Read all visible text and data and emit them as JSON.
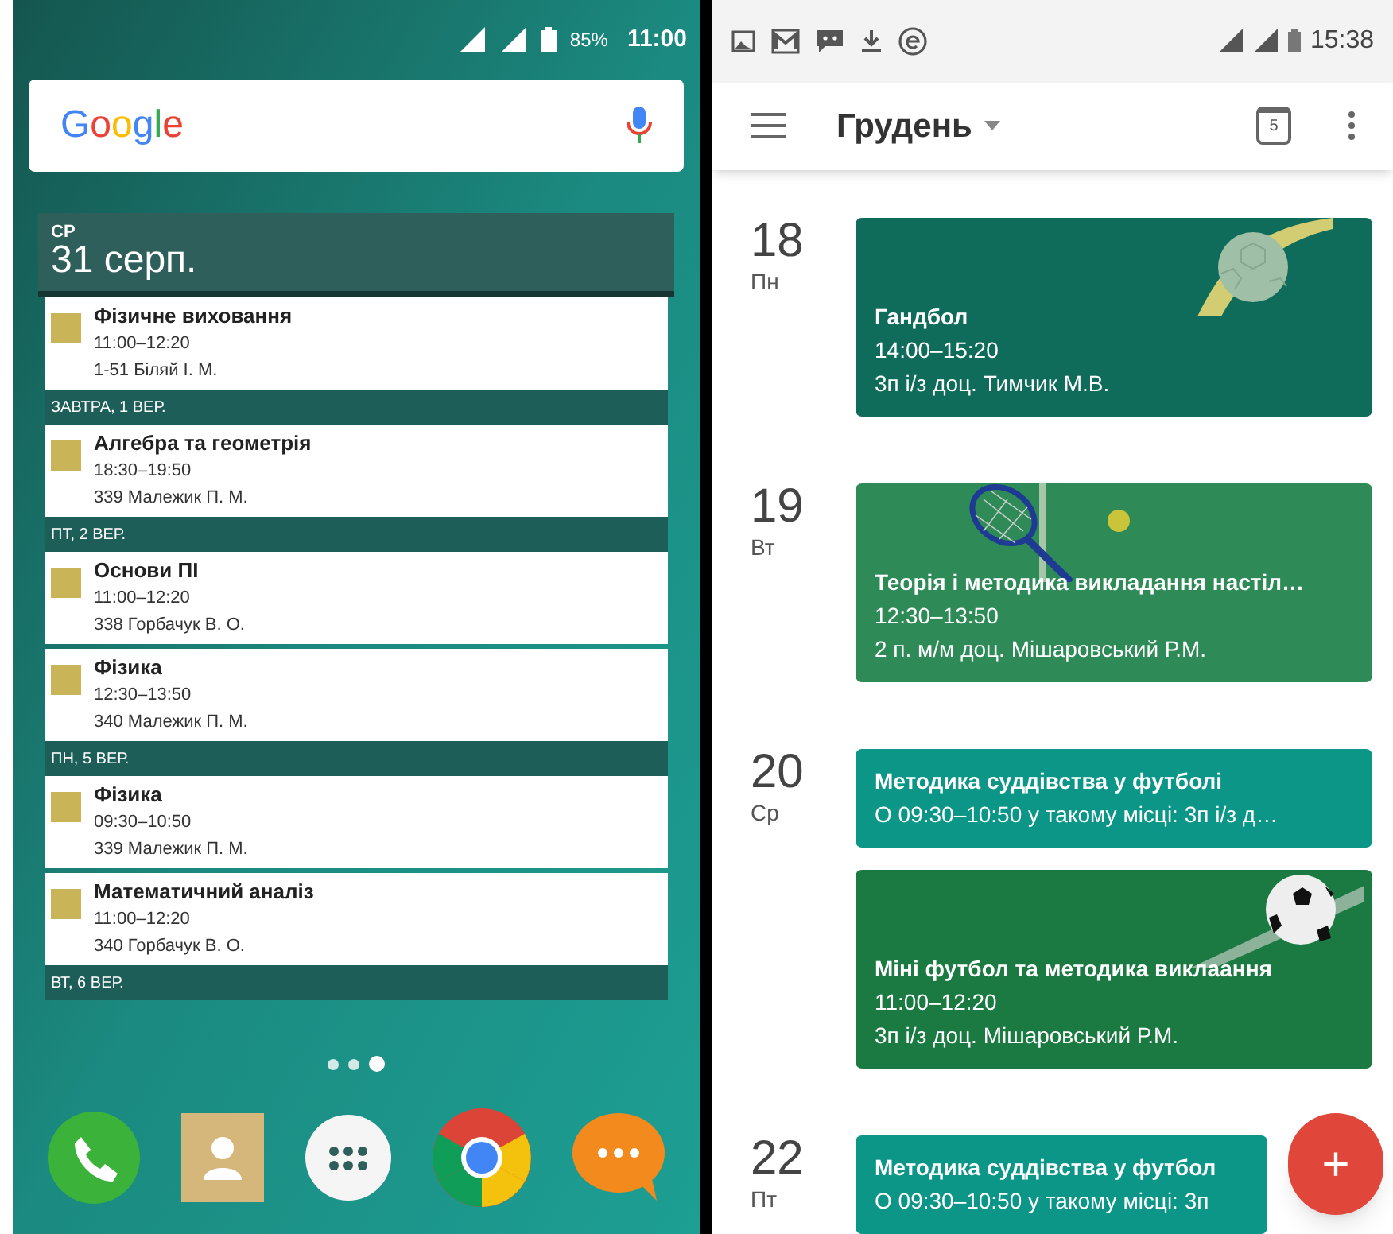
{
  "home_screen": {
    "status_bar": {
      "battery": "85%",
      "time": "11:00"
    },
    "search_bar": {
      "logo": "Google"
    },
    "agenda_widget": {
      "weekday": "СР",
      "date": "31 серп.",
      "items": [
        {
          "kind": "event",
          "title": "Фізичне виховання",
          "time": "11:00–12:20",
          "place": "1-51 Біляй І. М.",
          "color": "#c9b458"
        },
        {
          "kind": "day",
          "label": "ЗАВТРА, 1 ВЕР."
        },
        {
          "kind": "event",
          "title": "Алгебра та геометрія",
          "time": "18:30–19:50",
          "place": "339 Малежик П. М.",
          "color": "#c9b458"
        },
        {
          "kind": "day",
          "label": "ПТ, 2 ВЕР."
        },
        {
          "kind": "event",
          "title": "Основи ПІ",
          "time": "11:00–12:20",
          "place": "338 Горбачук В. О.",
          "color": "#c9b458"
        },
        {
          "kind": "event",
          "title": "Фізика",
          "time": "12:30–13:50",
          "place": "340 Малежик П. М.",
          "color": "#c9b458"
        },
        {
          "kind": "day",
          "label": "ПН, 5 ВЕР."
        },
        {
          "kind": "event",
          "title": "Фізика",
          "time": "09:30–10:50",
          "place": "339 Малежик П. М.",
          "color": "#c9b458"
        },
        {
          "kind": "event",
          "title": "Математичний аналіз",
          "time": "11:00–12:20",
          "place": "340 Горбачук В. О.",
          "color": "#c9b458"
        },
        {
          "kind": "day",
          "label": "ВТ, 6 ВЕР."
        }
      ]
    },
    "page_dots": [
      {
        "selected": false
      },
      {
        "selected": false
      },
      {
        "selected": true
      }
    ],
    "dock": [
      {
        "kind": "phone"
      },
      {
        "kind": "contacts"
      },
      {
        "kind": "apps"
      },
      {
        "kind": "browser"
      },
      {
        "kind": "messages"
      }
    ]
  },
  "calendar_app": {
    "status_bar": {
      "time": "15:38"
    },
    "app_bar": {
      "title": "Грудень",
      "today_icon_day": "5"
    },
    "days": [
      {
        "day": "18",
        "weekday": "Пн",
        "events": [
          {
            "kind": "handball",
            "title": "Гандбол",
            "time": "14:00–15:20",
            "place": "3п і/з доц. Тимчик М.В."
          }
        ]
      },
      {
        "day": "19",
        "weekday": "Вт",
        "events": [
          {
            "kind": "tennis",
            "title": "Теорія і методика викладання настіл…",
            "time": "12:30–13:50",
            "place": "2 п. м/м доц. Мішаровський Р.М."
          }
        ]
      },
      {
        "day": "20",
        "weekday": "Ср",
        "events": [
          {
            "kind": "plain",
            "title": "Методика суддівства у футболі",
            "subtitle": "О 09:30–10:50 у такому місці: 3п і/з д…"
          },
          {
            "kind": "football",
            "title": "Міні футбол та методика виклаання",
            "time": "11:00–12:20",
            "place": "3п і/з доц. Мішаровський Р.М."
          }
        ]
      },
      {
        "day": "22",
        "weekday": "Пт",
        "events": [
          {
            "kind": "plain",
            "title": "Методика суддівства у футбол",
            "subtitle": "О 09:30–10:50 у такому місці: 3п"
          }
        ]
      }
    ],
    "fab": {
      "label": "+"
    }
  }
}
